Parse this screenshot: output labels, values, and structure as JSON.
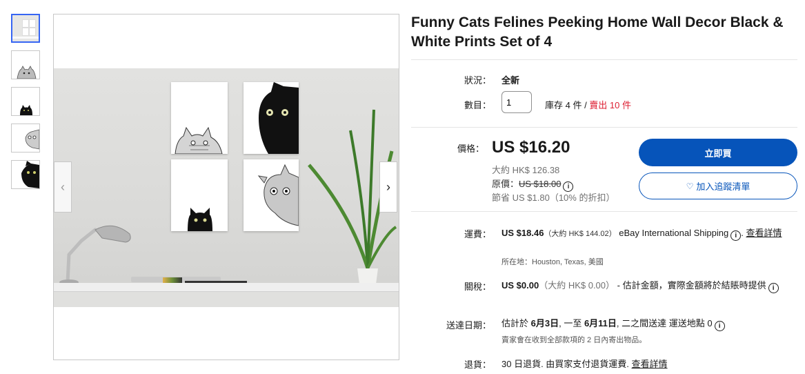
{
  "product": {
    "title": "Funny Cats Felines Peeking Home Wall Decor Black & White Prints Set of 4"
  },
  "condition": {
    "label": "狀況：",
    "value": "全新"
  },
  "quantity": {
    "label": "數目：",
    "value": "1",
    "stock": "庫存 4 件 / ",
    "sold": "賣出 10 件"
  },
  "price": {
    "label": "價格：",
    "value": "US $16.20",
    "approx": "大約 HK$ 126.38",
    "original_label": "原價：",
    "original_value": "US $18.00",
    "savings": "節省 US $1.80（10% 的折扣）"
  },
  "buttons": {
    "buy_now": "立即買",
    "watchlist": "加入追蹤清單"
  },
  "shipping": {
    "label": "運費：",
    "cost": "US $18.46",
    "approx": "（大約 HK$ 144.02）",
    "service": "eBay International Shipping",
    "see_details": "查看詳情",
    "location": "所在地：Houston, Texas, 美國"
  },
  "tax": {
    "label": "關稅：",
    "value": "US $0.00",
    "approx": "（大約 HK$ 0.00）",
    "note": "- 估計金額，實際金額將於結賬時提供"
  },
  "delivery": {
    "label": "送達日期：",
    "pre": "估計於 ",
    "date1": "6月3日",
    "mid": ", 一至 ",
    "date2": "6月11日",
    "post": ", 二之間送達 運送地點 0",
    "note": "賣家會在收到全部款項的 2 日內寄出物品。"
  },
  "returns": {
    "label": "退貨：",
    "text": "30 日退貨. 由買家支付退貨運費.",
    "see_details": "查看詳情"
  },
  "icons": {
    "info": "info-icon",
    "heart": "heart-icon",
    "prev": "chevron-left-icon",
    "next": "chevron-right-icon"
  },
  "colors": {
    "primary": "#0654ba",
    "sold_red": "#dd1e31",
    "active_thumb": "#3665f3"
  }
}
